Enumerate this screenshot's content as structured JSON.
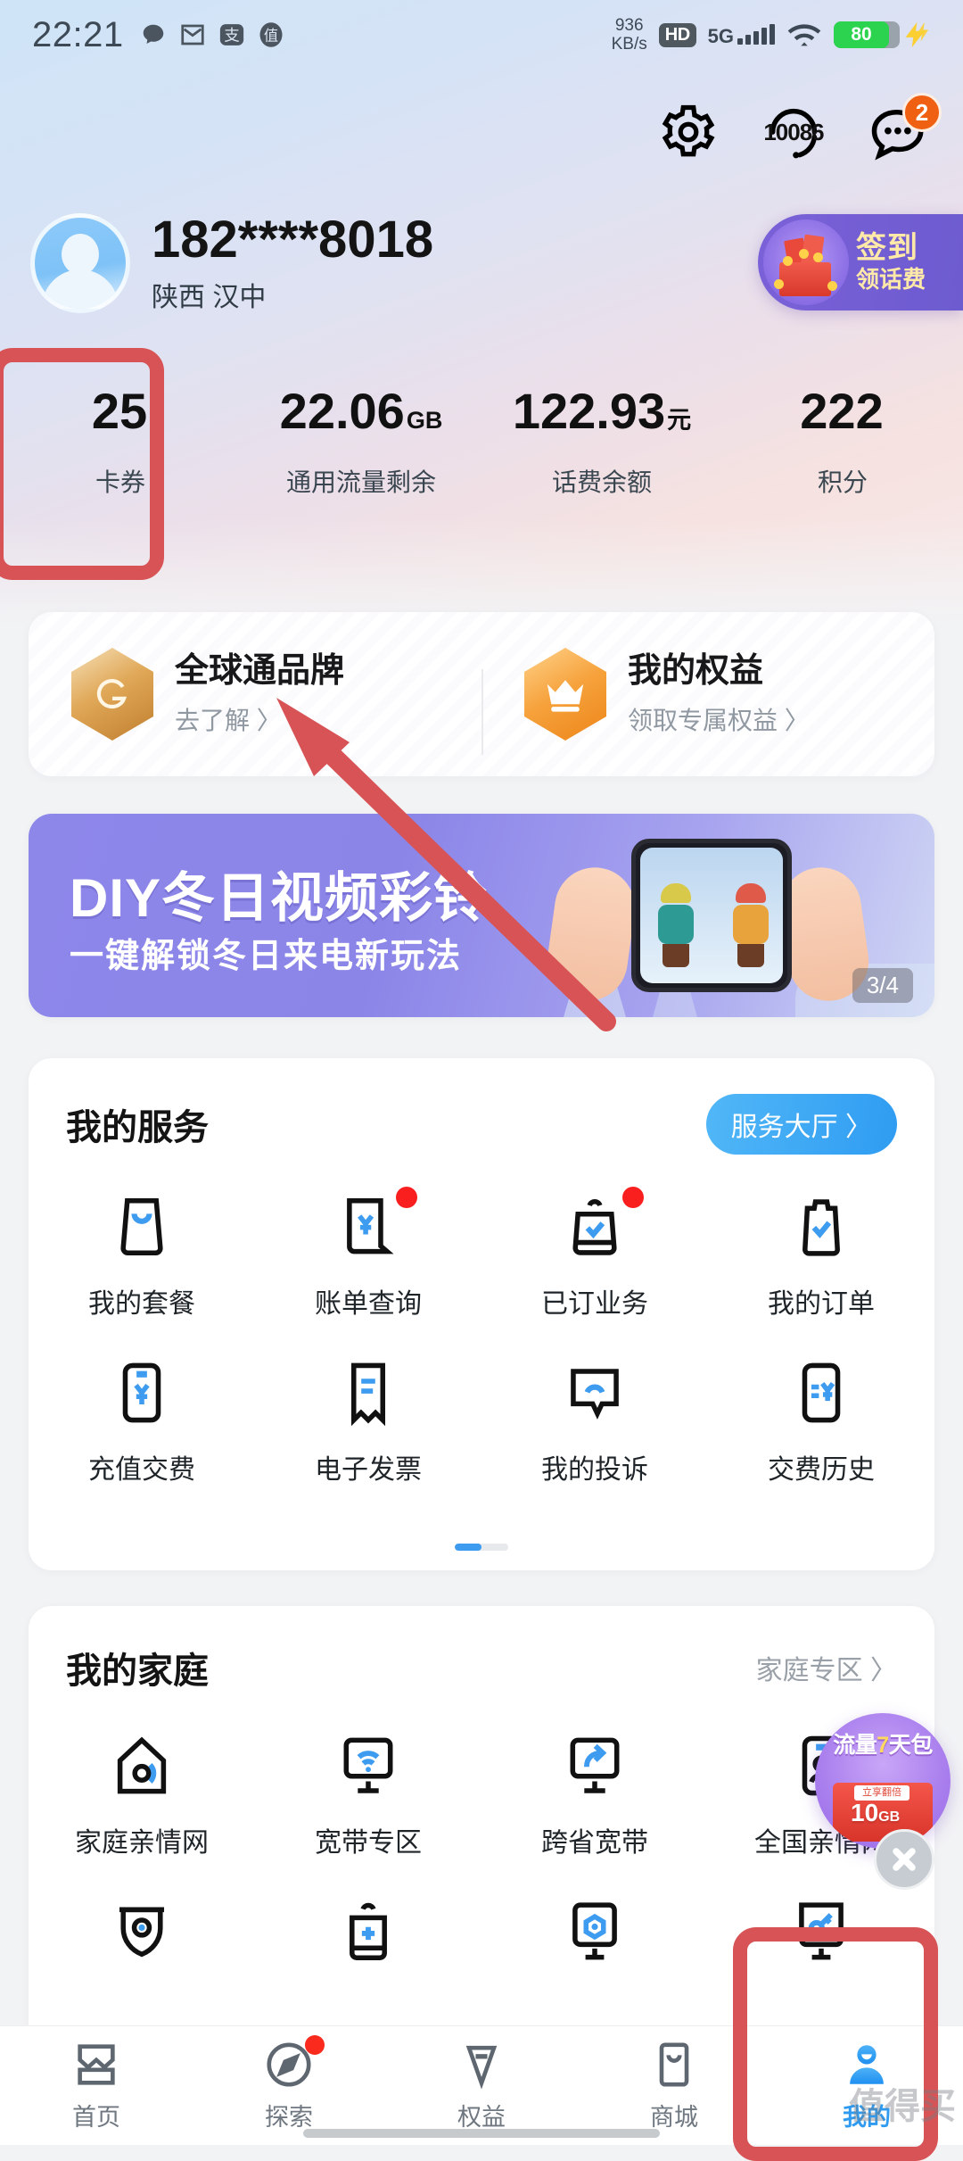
{
  "statusbar": {
    "time": "22:21",
    "icons": [
      "chat-bubble-icon",
      "mail-icon",
      "alipay-icon",
      "zhi-icon"
    ],
    "netspeed_value": "936",
    "netspeed_unit": "KB/s",
    "hd_label": "HD",
    "network_type": "5G",
    "battery_level": "80",
    "battery_color": "#2bd34e"
  },
  "header": {
    "settings_icon": "gear-icon",
    "hotline_icon": "headset-icon",
    "hotline_label": "10086",
    "messages_icon": "chat-icon",
    "messages_badge": "2",
    "badge_color": "#ef6012"
  },
  "profile": {
    "avatar": "user-avatar-icon",
    "phone": "182****8018",
    "region": "陕西 汉中"
  },
  "signin": {
    "title": "签到",
    "subtitle": "领话费",
    "icon": "gift-box-icon"
  },
  "stats": [
    {
      "value": "25",
      "unit": "",
      "label": "卡券"
    },
    {
      "value": "22.06",
      "unit": "GB",
      "label": "通用流量剩余"
    },
    {
      "value": "122.93",
      "unit": "元",
      "label": "话费余额"
    },
    {
      "value": "222",
      "unit": "",
      "label": "积分"
    }
  ],
  "brand_card": [
    {
      "icon": "gotone-hex-icon",
      "title": "全球通品牌",
      "sub": "去了解 〉"
    },
    {
      "icon": "crown-hex-icon",
      "title": "我的权益",
      "sub": "领取专属权益 〉"
    }
  ],
  "banner": {
    "title": "DIY冬日视频彩铃",
    "subtitle": "一键解锁冬日来电新玩法",
    "indicator": "3/4"
  },
  "services": {
    "title": "我的服务",
    "action_label": "服务大厅 〉",
    "items": [
      {
        "icon": "package-icon",
        "label": "我的套餐",
        "badge": false
      },
      {
        "icon": "bill-yuan-icon",
        "label": "账单查询",
        "badge": true
      },
      {
        "icon": "subscribed-check-icon",
        "label": "已订业务",
        "badge": true
      },
      {
        "icon": "clipboard-check-icon",
        "label": "我的订单",
        "badge": false
      },
      {
        "icon": "recharge-yuan-icon",
        "label": "充值交费",
        "badge": false
      },
      {
        "icon": "invoice-icon",
        "label": "电子发票",
        "badge": false
      },
      {
        "icon": "complaint-bubble-icon",
        "label": "我的投诉",
        "badge": false
      },
      {
        "icon": "payment-history-icon",
        "label": "交费历史",
        "badge": false
      }
    ]
  },
  "family": {
    "title": "我的家庭",
    "action_label": "家庭专区 〉",
    "items": [
      {
        "icon": "home-network-icon",
        "label": "家庭亲情网"
      },
      {
        "icon": "broadband-wifi-icon",
        "label": "宽带专区"
      },
      {
        "icon": "cross-province-broadband-icon",
        "label": "跨省宽带"
      },
      {
        "icon": "national-family-icon",
        "label": "全国亲情网"
      },
      {
        "icon": "camera-shield-icon",
        "label": ""
      },
      {
        "icon": "add-device-icon",
        "label": ""
      },
      {
        "icon": "smart-screen-icon",
        "label": ""
      },
      {
        "icon": "key-device-icon",
        "label": ""
      }
    ]
  },
  "float_ad": {
    "title_prefix": "流量",
    "title_highlight": "7",
    "title_suffix": "天包",
    "tag": "立享翻倍",
    "amount": "10",
    "amount_unit": "GB",
    "close_icon": "close-icon"
  },
  "bottom_nav": [
    {
      "icon": "home-icon",
      "label": "首页",
      "active": false,
      "badge": false
    },
    {
      "icon": "compass-icon",
      "label": "探索",
      "active": false,
      "badge": true
    },
    {
      "icon": "diamond-icon",
      "label": "权益",
      "active": false,
      "badge": false
    },
    {
      "icon": "store-icon",
      "label": "商城",
      "active": false,
      "badge": false
    },
    {
      "icon": "profile-icon",
      "label": "我的",
      "active": true,
      "badge": false
    }
  ],
  "annotations": {
    "color": "#d85355",
    "watermark": "值得买"
  }
}
